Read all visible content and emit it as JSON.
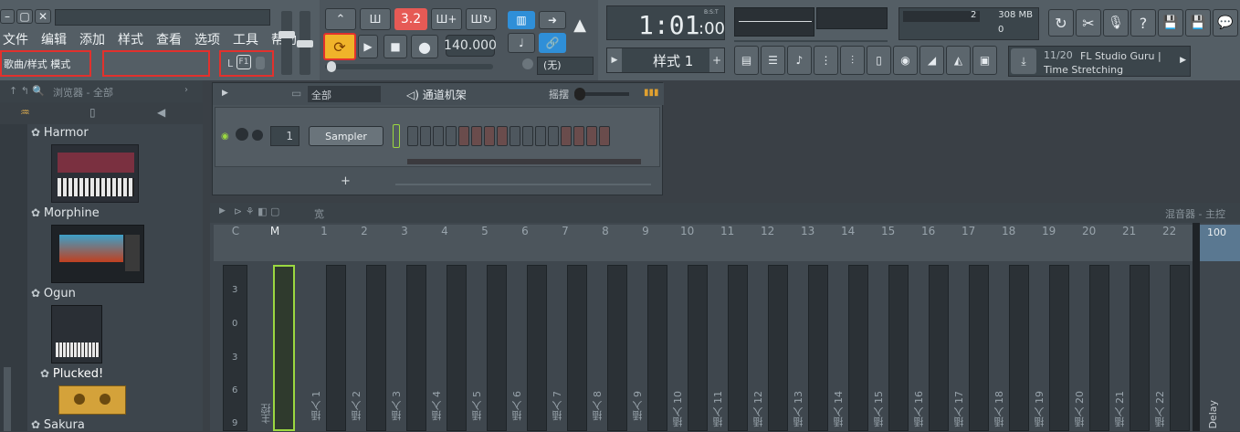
{
  "menu": [
    "文件",
    "编辑",
    "添加",
    "样式",
    "查看",
    "选项",
    "工具",
    "帮助"
  ],
  "mode_label": "歌曲/样式 模式",
  "keyboard_label": "F1",
  "lr_label": "L",
  "transport": {
    "pattern_num": "3.2",
    "tempo": "140.000",
    "time": "1:01",
    "time_sub": ":00",
    "bst": "B:S:T",
    "none_label": "(无)"
  },
  "memory": {
    "mb": "308 MB",
    "cpu_voices": "2",
    "zero": "0"
  },
  "pattern_selector": {
    "label": "样式 1"
  },
  "hint": {
    "counter": "11/20",
    "text": "FL Studio Guru | Time Stretching"
  },
  "browser": {
    "title": "浏览器 - 全部",
    "items": [
      "Harmor",
      "Morphine",
      "Ogun",
      "Plucked!",
      "Sakura"
    ]
  },
  "channel_rack": {
    "filter": "全部",
    "title": "通道机架",
    "swing_label": "摇摆",
    "instrument": "Sampler",
    "channel_num": "1",
    "add": "+"
  },
  "mixer": {
    "title": "混音器 - 主控",
    "wide_label": "宽",
    "headers": [
      "C",
      "M",
      "1",
      "2",
      "3",
      "4",
      "5",
      "6",
      "7",
      "8",
      "9",
      "10",
      "11",
      "12",
      "13",
      "14",
      "15",
      "16",
      "17",
      "18",
      "19",
      "20",
      "21",
      "22"
    ],
    "master_label": "主控",
    "insert_labels": [
      "插入 1",
      "插入 2",
      "插入 3",
      "插入 4",
      "插入 5",
      "插入 6",
      "插入 7",
      "插入 8",
      "插入 9",
      "插入 10",
      "插入 11",
      "插入 12",
      "插入 13",
      "插入 14",
      "插入 15",
      "插入 16",
      "插入 17",
      "插入 18",
      "插入 19",
      "插入 20",
      "插入 21",
      "插入 22"
    ],
    "db_marks": [
      "3",
      "0",
      "3",
      "6",
      "9"
    ],
    "delay_label": "Delay",
    "delay_value": "100"
  }
}
